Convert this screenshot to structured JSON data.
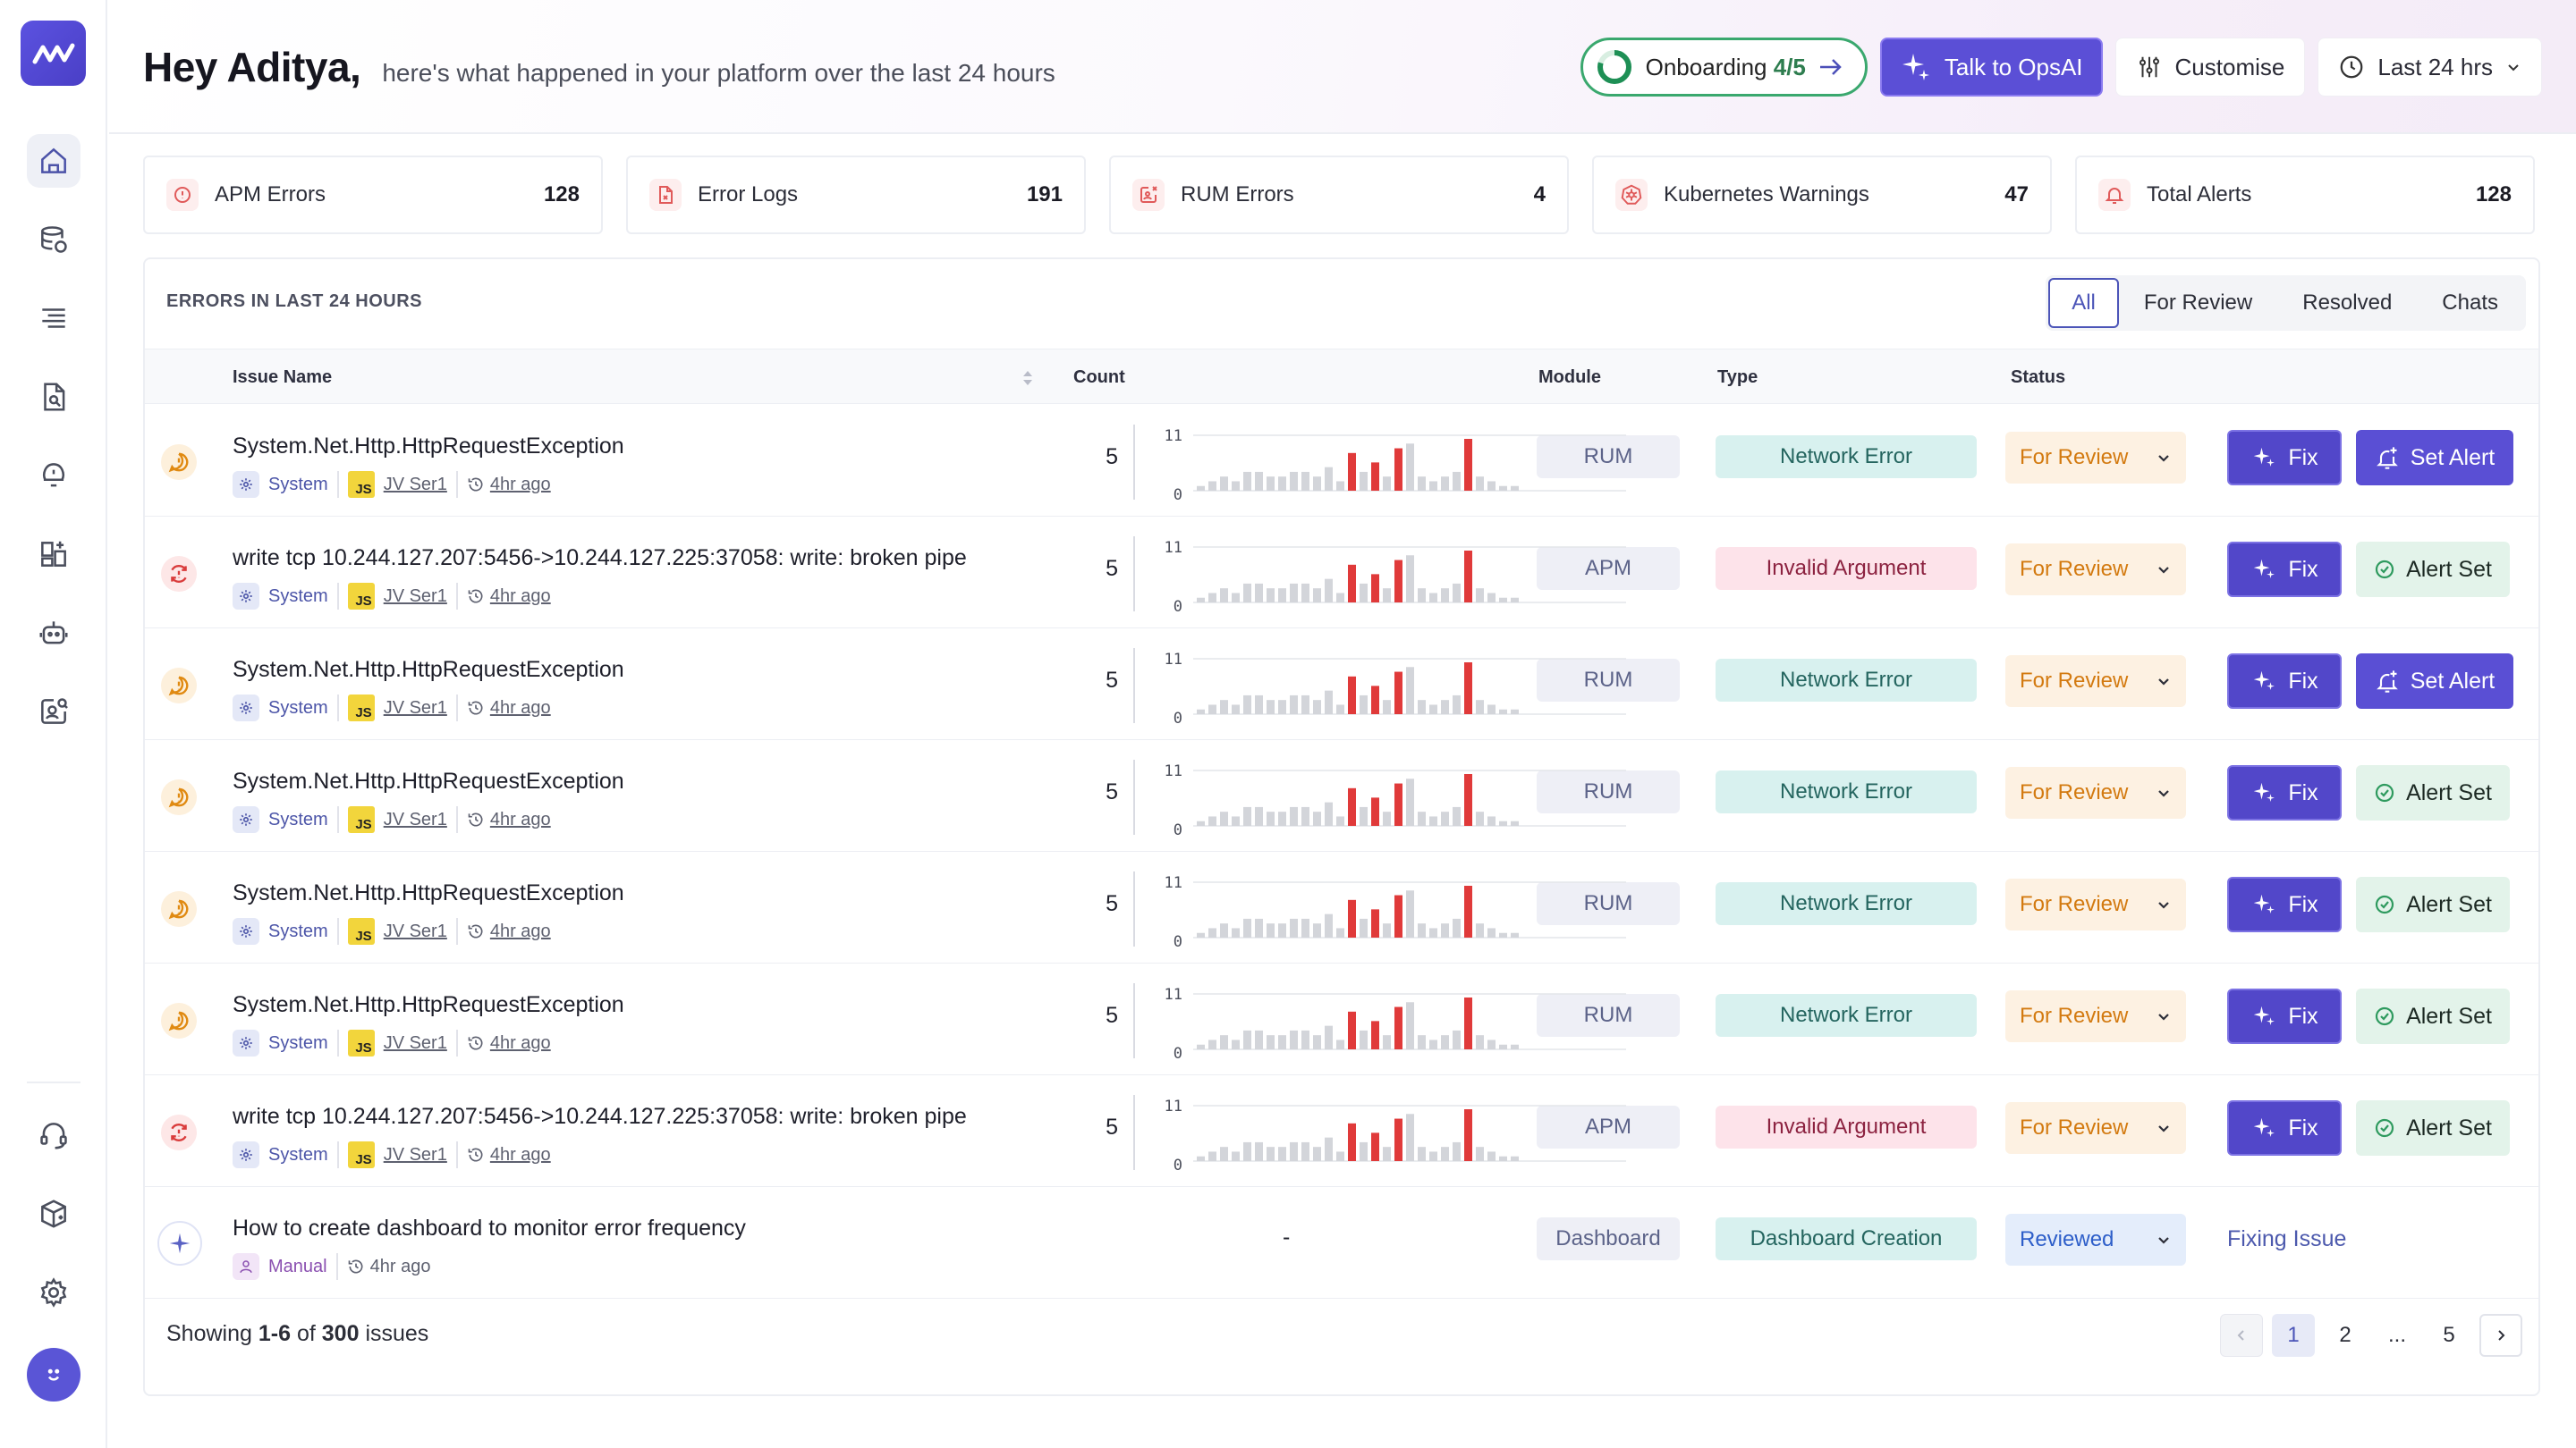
{
  "header": {
    "greeting": "Hey Aditya,",
    "subtitle": "here's what happened in your platform over the last 24 hours",
    "onboarding_label": "Onboarding",
    "onboarding_progress": "4/5",
    "opsai_label": "Talk to OpsAI",
    "customise_label": "Customise",
    "timerange_label": "Last 24 hrs"
  },
  "summary_cards": [
    {
      "label": "APM Errors",
      "value": "128",
      "icon": "alert-circle-icon",
      "color": "#e05a5a"
    },
    {
      "label": "Error Logs",
      "value": "191",
      "icon": "file-error-icon",
      "color": "#e05a5a"
    },
    {
      "label": "RUM Errors",
      "value": "4",
      "icon": "rum-error-icon",
      "color": "#e05a5a"
    },
    {
      "label": "Kubernetes Warnings",
      "value": "47",
      "icon": "kubernetes-icon",
      "color": "#e05a5a"
    },
    {
      "label": "Total Alerts",
      "value": "128",
      "icon": "bell-icon",
      "color": "#e05a5a"
    }
  ],
  "errors_panel": {
    "title": "ERRORS IN LAST 24 HOURS",
    "filters": [
      "All",
      "For Review",
      "Resolved",
      "Chats"
    ],
    "active_filter": "All",
    "columns": {
      "issue": "Issue Name",
      "count": "Count",
      "module": "Module",
      "type": "Type",
      "status": "Status"
    },
    "sparkline_max": "11",
    "sparkline_min": "0",
    "sparkline_values": [
      1,
      2,
      3,
      2,
      4,
      4,
      3,
      3,
      4,
      4,
      3,
      5,
      2,
      8,
      4,
      6,
      3,
      9,
      10,
      3,
      2,
      3,
      4,
      11,
      3,
      2,
      1,
      1
    ],
    "sparkline_highlight": [
      13,
      15,
      17,
      23
    ],
    "rows": [
      {
        "title": "System.Net.Http.HttpRequestException",
        "source": "System",
        "service": "JV Ser1",
        "time": "4hr ago",
        "count": "5",
        "module": "RUM",
        "type": "Network Error",
        "type_kind": "net",
        "status": "For Review",
        "fix": "Fix",
        "alert": "Set Alert",
        "alert_state": "set",
        "severity": "warning"
      },
      {
        "title": "write tcp 10.244.127.207:5456->10.244.127.225:37058: write: broken pipe",
        "source": "System",
        "service": "JV Ser1",
        "time": "4hr ago",
        "count": "5",
        "module": "APM",
        "type": "Invalid Argument",
        "type_kind": "inv",
        "status": "For Review",
        "fix": "Fix",
        "alert": "Alert Set",
        "alert_state": "done",
        "severity": "error"
      },
      {
        "title": "System.Net.Http.HttpRequestException",
        "source": "System",
        "service": "JV Ser1",
        "time": "4hr ago",
        "count": "5",
        "module": "RUM",
        "type": "Network Error",
        "type_kind": "net",
        "status": "For Review",
        "fix": "Fix",
        "alert": "Set Alert",
        "alert_state": "set",
        "severity": "warning"
      },
      {
        "title": "System.Net.Http.HttpRequestException",
        "source": "System",
        "service": "JV Ser1",
        "time": "4hr ago",
        "count": "5",
        "module": "RUM",
        "type": "Network Error",
        "type_kind": "net",
        "status": "For Review",
        "fix": "Fix",
        "alert": "Alert Set",
        "alert_state": "done",
        "severity": "warning"
      },
      {
        "title": "System.Net.Http.HttpRequestException",
        "source": "System",
        "service": "JV Ser1",
        "time": "4hr ago",
        "count": "5",
        "module": "RUM",
        "type": "Network Error",
        "type_kind": "net",
        "status": "For Review",
        "fix": "Fix",
        "alert": "Alert Set",
        "alert_state": "done",
        "severity": "warning"
      },
      {
        "title": "System.Net.Http.HttpRequestException",
        "source": "System",
        "service": "JV Ser1",
        "time": "4hr ago",
        "count": "5",
        "module": "RUM",
        "type": "Network Error",
        "type_kind": "net",
        "status": "For Review",
        "fix": "Fix",
        "alert": "Alert Set",
        "alert_state": "done",
        "severity": "warning"
      },
      {
        "title": "write tcp 10.244.127.207:5456->10.244.127.225:37058: write: broken pipe",
        "source": "System",
        "service": "JV Ser1",
        "time": "4hr ago",
        "count": "5",
        "module": "APM",
        "type": "Invalid Argument",
        "type_kind": "inv",
        "status": "For Review",
        "fix": "Fix",
        "alert": "Alert Set",
        "alert_state": "done",
        "severity": "error"
      }
    ],
    "chat_row": {
      "title": "How to create dashboard to monitor error frequency",
      "source": "Manual",
      "time": "4hr ago",
      "count": "-",
      "module": "Dashboard",
      "type": "Dashboard Creation",
      "status": "Reviewed",
      "action": "Fixing Issue"
    },
    "footer": {
      "prefix": "Showing",
      "range": "1-6",
      "of": "of",
      "total": "300",
      "suffix": "issues"
    },
    "pagination": {
      "pages": [
        "1",
        "2",
        "...",
        "5"
      ],
      "current": "1"
    }
  },
  "sidebar": {
    "items": [
      "home-icon",
      "database-icon",
      "logs-icon",
      "file-search-icon",
      "alert-bulb-icon",
      "dashboard-add-icon",
      "robot-icon",
      "user-search-icon"
    ],
    "bottom_items": [
      "support-headset-icon",
      "package-icon",
      "settings-gear-icon"
    ]
  }
}
